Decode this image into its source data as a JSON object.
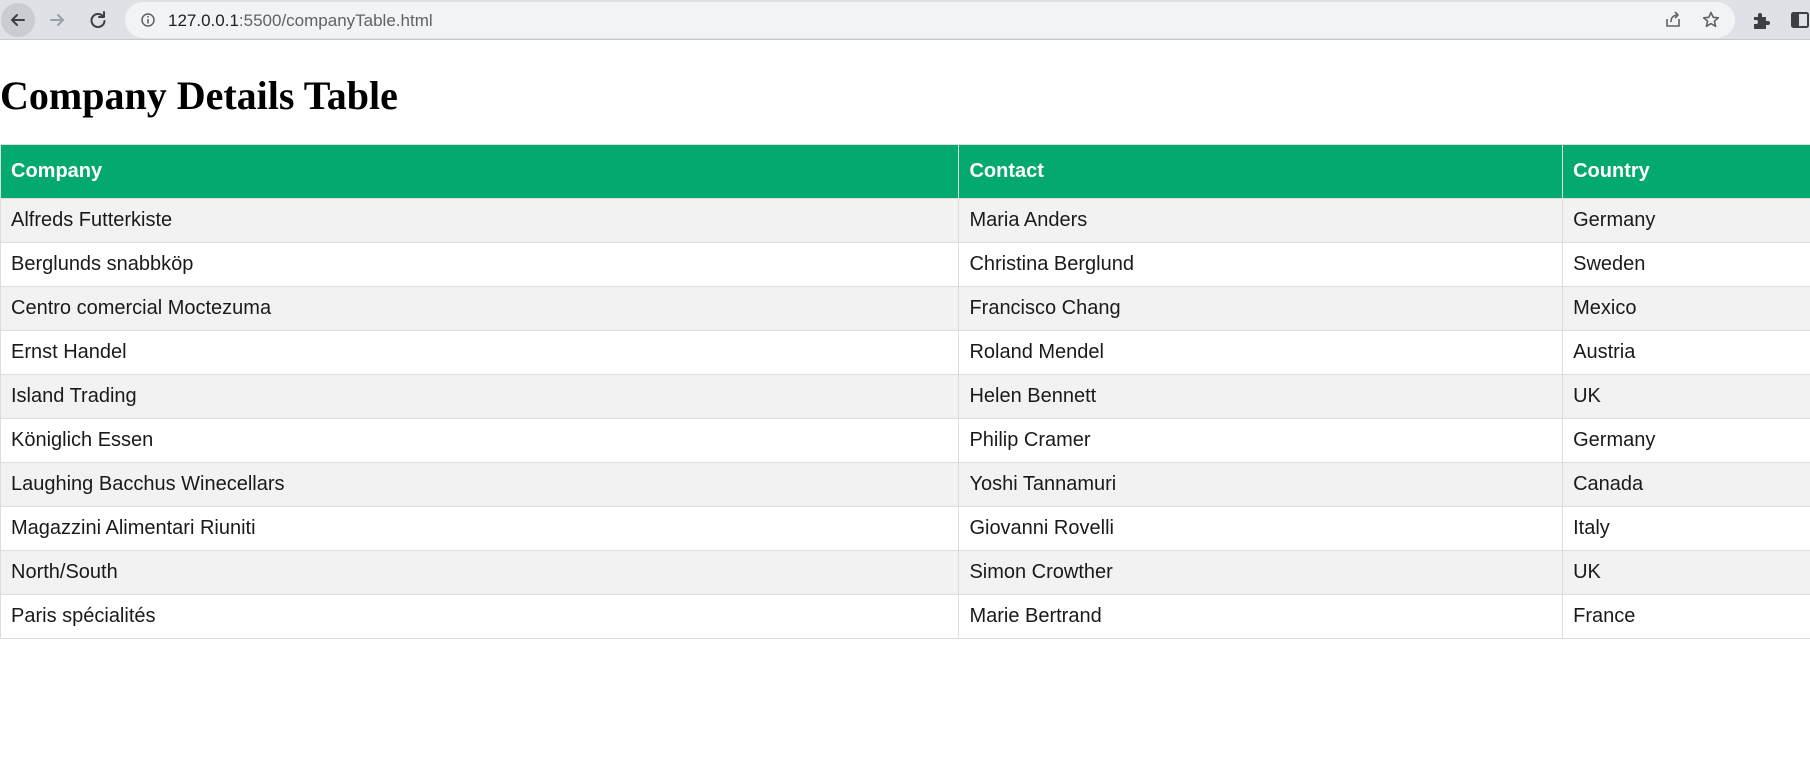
{
  "browser": {
    "url_host": "127.0.0.1",
    "url_path": ":5500/companyTable.html"
  },
  "page": {
    "title": "Company Details Table"
  },
  "table": {
    "headers": [
      "Company",
      "Contact",
      "Country"
    ],
    "rows": [
      [
        "Alfreds Futterkiste",
        "Maria Anders",
        "Germany"
      ],
      [
        "Berglunds snabbköp",
        "Christina Berglund",
        "Sweden"
      ],
      [
        "Centro comercial Moctezuma",
        "Francisco Chang",
        "Mexico"
      ],
      [
        "Ernst Handel",
        "Roland Mendel",
        "Austria"
      ],
      [
        "Island Trading",
        "Helen Bennett",
        "UK"
      ],
      [
        "Königlich Essen",
        "Philip Cramer",
        "Germany"
      ],
      [
        "Laughing Bacchus Winecellars",
        "Yoshi Tannamuri",
        "Canada"
      ],
      [
        "Magazzini Alimentari Riuniti",
        "Giovanni Rovelli",
        "Italy"
      ],
      [
        "North/South",
        "Simon Crowther",
        "UK"
      ],
      [
        "Paris spécialités",
        "Marie Bertrand",
        "France"
      ]
    ]
  },
  "colors": {
    "header_bg": "#04aa6d",
    "header_text": "#ffffff",
    "stripe_bg": "#f2f2f2"
  },
  "icons": [
    "back-arrow-icon",
    "forward-arrow-icon",
    "reload-icon",
    "info-icon",
    "share-icon",
    "star-icon",
    "extensions-icon",
    "side-panel-icon"
  ]
}
